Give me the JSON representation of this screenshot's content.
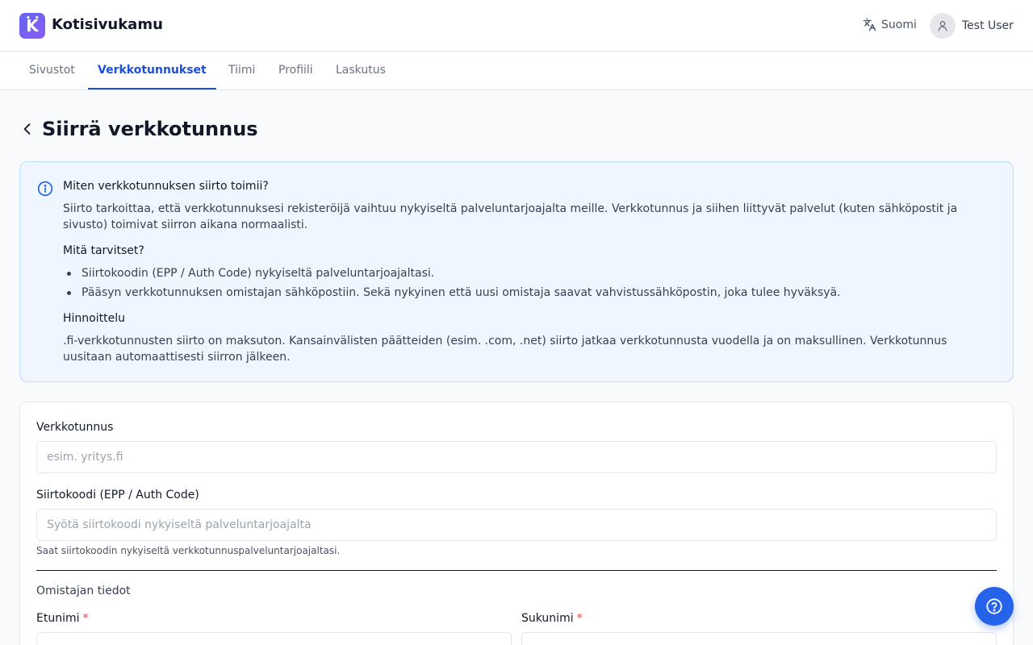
{
  "header": {
    "logo_letter": "K",
    "brand": "Kotisivukamu",
    "language": "Suomi",
    "user_name": "Test User"
  },
  "tabs": [
    {
      "label": "Sivustot",
      "active": false
    },
    {
      "label": "Verkkotunnukset",
      "active": true
    },
    {
      "label": "Tiimi",
      "active": false
    },
    {
      "label": "Profiili",
      "active": false
    },
    {
      "label": "Laskutus",
      "active": false
    }
  ],
  "page": {
    "title": "Siirrä verkkotunnus"
  },
  "info": {
    "heading": "Miten verkkotunnuksen siirto toimii?",
    "intro": "Siirto tarkoittaa, että verkkotunnuksesi rekisteröijä vaihtuu nykyiseltä palveluntarjoajalta meille. Verkkotunnus ja siihen liittyvät palvelut (kuten sähköpostit ja sivusto) toimivat siirron aikana normaalisti.",
    "needs_heading": "Mitä tarvitset?",
    "needs": [
      "Siirtokoodin (EPP / Auth Code) nykyiseltä palveluntarjoajaltasi.",
      "Pääsyn verkkotunnuksen omistajan sähköpostiin. Sekä nykyinen että uusi omistaja saavat vahvistussähköpostin, joka tulee hyväksyä."
    ],
    "pricing_heading": "Hinnoittelu",
    "pricing_text": ".fi-verkkotunnusten siirto on maksuton. Kansainvälisten päätteiden (esim. .com, .net) siirto jatkaa verkkotunnusta vuodella ja on maksullinen. Verkkotunnus uusitaan automaattisesti siirron jälkeen."
  },
  "form": {
    "domain_label": "Verkkotunnus",
    "domain_placeholder": "esim. yritys.fi",
    "domain_value": "",
    "auth_label": "Siirtokoodi (EPP / Auth Code)",
    "auth_placeholder": "Syötä siirtokoodi nykyiseltä palveluntarjoajalta",
    "auth_value": "",
    "auth_hint": "Saat siirtokoodin nykyiseltä verkkotunnuspalveluntarjoajaltasi.",
    "owner_section": "Omistajan tiedot",
    "first_name_label": "Etunimi",
    "last_name_label": "Sukunimi",
    "required_mark": "*"
  },
  "colors": {
    "accent": "#1d4ed8",
    "info_bg": "#eff6ff",
    "info_border": "#bfdbfe",
    "required": "#ef4444",
    "fab": "#2563eb"
  },
  "icons": {
    "back": "chevron-left-icon",
    "info": "info-circle-icon",
    "language": "translate-icon",
    "user": "user-icon",
    "help": "help-circle-icon"
  }
}
